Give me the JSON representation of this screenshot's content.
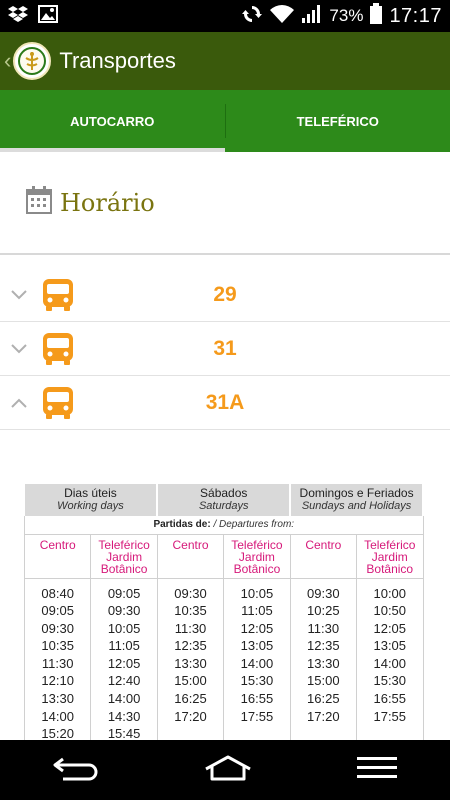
{
  "status_bar": {
    "battery_percent": "73%",
    "time": "17:17",
    "icons_left": [
      "dropbox-icon",
      "gallery-icon"
    ],
    "icons_right": [
      "sync-icon",
      "wifi-icon",
      "signal-icon",
      "battery-icon"
    ]
  },
  "app_bar": {
    "title": "Transportes"
  },
  "tabs": [
    {
      "label": "AUTOCARRO",
      "active": true
    },
    {
      "label": "TELEFÉRICO",
      "active": false
    }
  ],
  "section": {
    "title": "Horário"
  },
  "routes": [
    {
      "number": "29",
      "expanded": false
    },
    {
      "number": "31",
      "expanded": false
    },
    {
      "number": "31A",
      "expanded": true
    }
  ],
  "timetable": {
    "days": [
      {
        "pt": "Dias úteis",
        "en": "Working days"
      },
      {
        "pt": "Sábados",
        "en": "Saturdays"
      },
      {
        "pt": "Domingos e Feriados",
        "en": "Sundays and Holidays"
      }
    ],
    "partidas_pt": "Partidas de:",
    "partidas_en": "/ Departures from:",
    "stop_centro": "Centro",
    "stop_teleferico_1": "Teleférico",
    "stop_teleferico_2": "Jardim",
    "stop_teleferico_3": "Botânico",
    "columns": [
      [
        "08:40",
        "09:05",
        "09:30",
        "10:35",
        "11:30",
        "12:10",
        "13:30",
        "14:00",
        "15:20"
      ],
      [
        "09:05",
        "09:30",
        "10:05",
        "11:05",
        "12:05",
        "12:40",
        "14:00",
        "14:30",
        "15:45"
      ],
      [
        "09:30",
        "10:35",
        "11:30",
        "12:35",
        "13:30",
        "15:00",
        "16:25",
        "17:20"
      ],
      [
        "10:05",
        "11:05",
        "12:05",
        "13:05",
        "14:00",
        "15:30",
        "16:55",
        "17:55"
      ],
      [
        "09:30",
        "10:25",
        "11:30",
        "12:35",
        "13:30",
        "15:00",
        "16:25",
        "17:20"
      ],
      [
        "10:00",
        "10:50",
        "12:05",
        "13:05",
        "14:00",
        "15:30",
        "16:55",
        "17:55"
      ]
    ]
  },
  "colors": {
    "app_bar": "#3a5a0c",
    "tabs": "#2d8a1a",
    "route_number": "#f59a1b",
    "stop_header": "#d6197a",
    "section_title": "#7a7410"
  },
  "nav_bar": {
    "icons": [
      "back-icon",
      "home-icon",
      "menu-icon"
    ]
  }
}
